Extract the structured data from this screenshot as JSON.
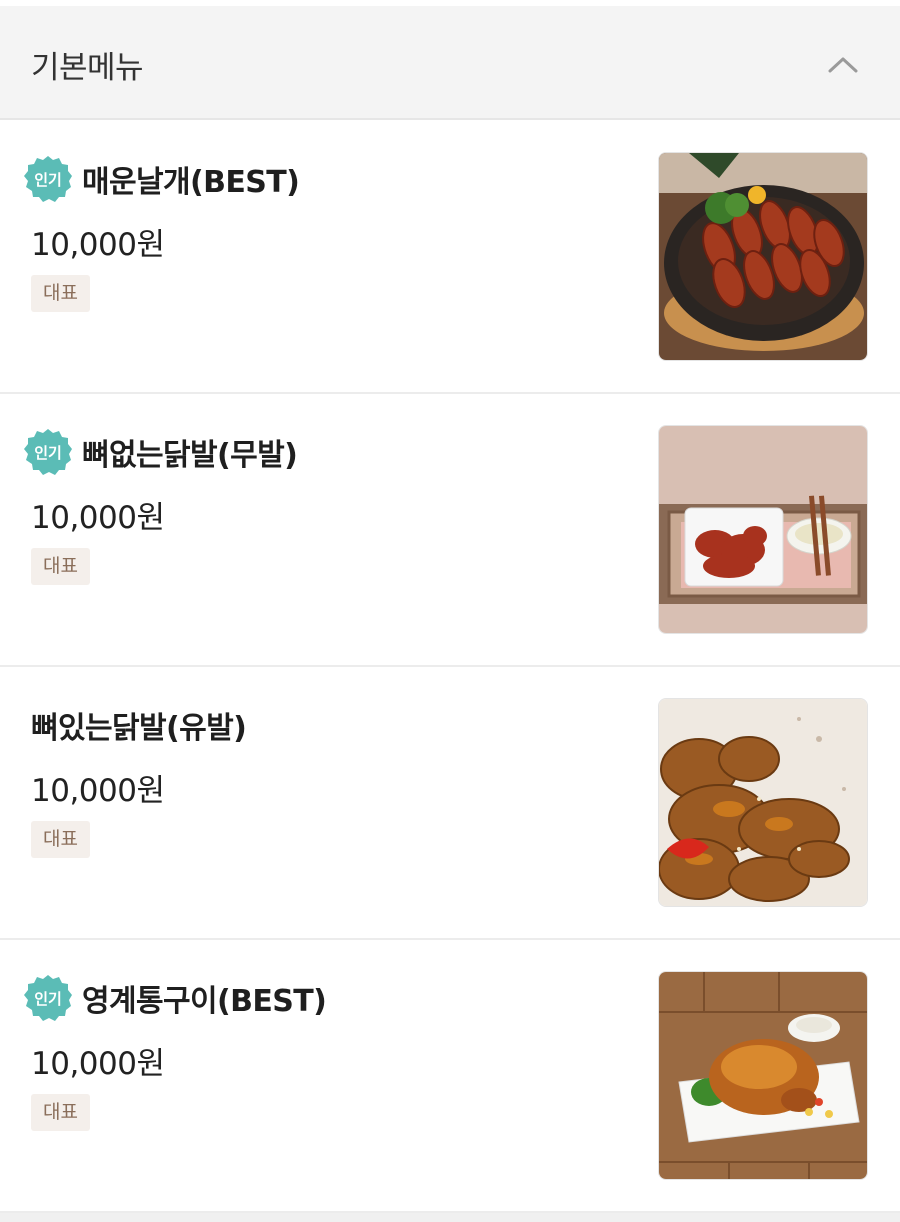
{
  "section": {
    "title": "기본메뉴",
    "collapse_icon": "chevron-up-icon"
  },
  "popular_badge": "인기",
  "menu_items": [
    {
      "name": "매운날개(BEST)",
      "price": "10,000원",
      "tag": "대표",
      "popular": true,
      "image": "spicy-wings-photo"
    },
    {
      "name": "뼈없는닭발(무발)",
      "price": "10,000원",
      "tag": "대표",
      "popular": true,
      "image": "boneless-chicken-feet-photo"
    },
    {
      "name": "뼈있는닭발(유발)",
      "price": "10,000원",
      "tag": "대표",
      "popular": false,
      "image": "bone-in-chicken-feet-photo"
    },
    {
      "name": "영계통구이(BEST)",
      "price": "10,000원",
      "tag": "대표",
      "popular": true,
      "image": "roast-whole-chicken-photo"
    }
  ],
  "colors": {
    "badge": "#5bbcb6",
    "tag_bg": "#f4efeb",
    "tag_text": "#8a6e5a",
    "header_bg": "#f4f4f4"
  }
}
